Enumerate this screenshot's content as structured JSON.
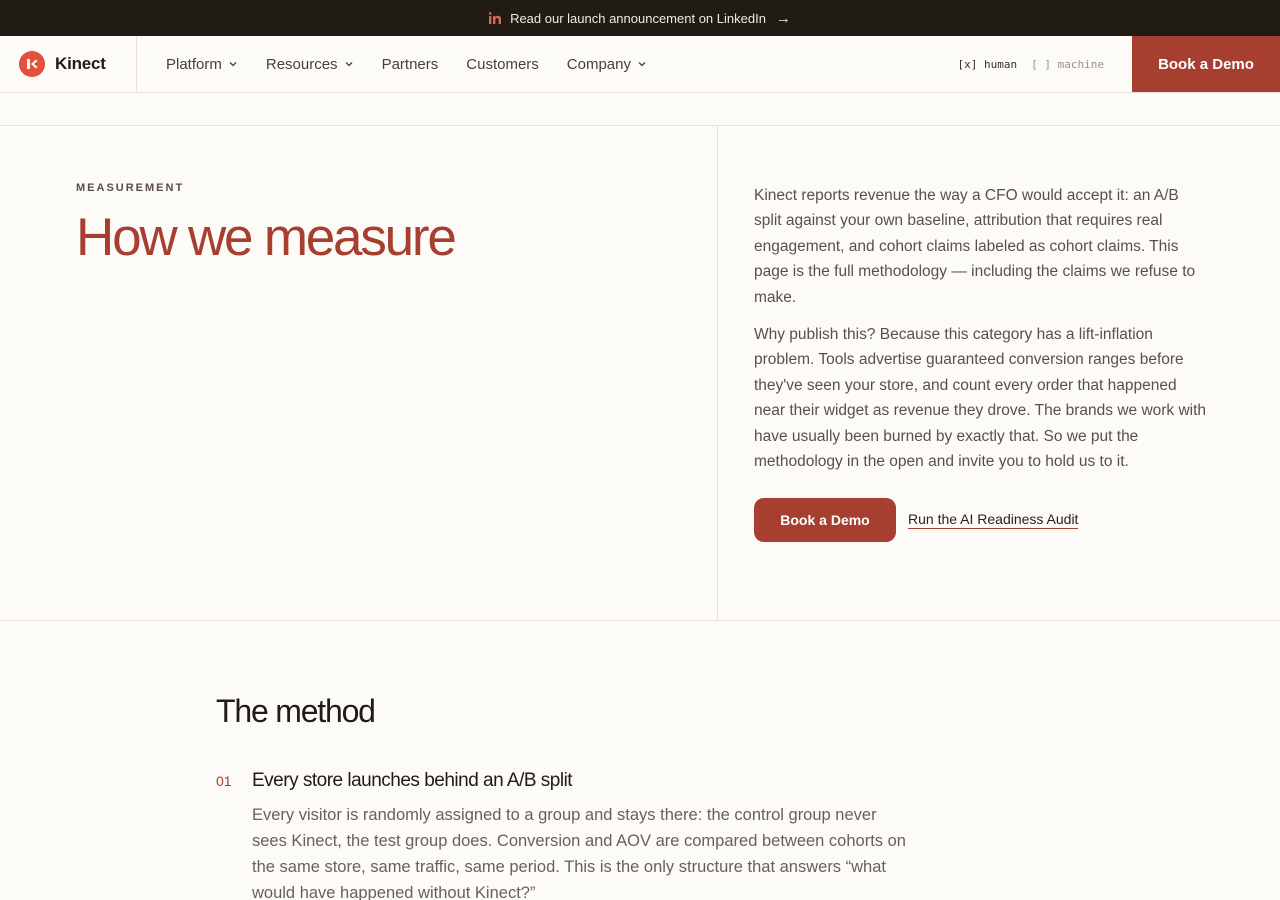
{
  "announcement": {
    "text": "Read our launch announcement on LinkedIn",
    "arrow": "→",
    "icon": "linkedin-icon"
  },
  "brand": {
    "name": "Kinect",
    "logo_color": "#e2513b"
  },
  "nav": {
    "items": [
      {
        "label": "Platform",
        "has_dropdown": true
      },
      {
        "label": "Resources",
        "has_dropdown": true
      },
      {
        "label": "Partners",
        "has_dropdown": false
      },
      {
        "label": "Customers",
        "has_dropdown": false
      },
      {
        "label": "Company",
        "has_dropdown": true
      }
    ],
    "mode_toggle": {
      "human": "[x] human",
      "machine": "[ ] machine"
    },
    "cta": "Book a Demo"
  },
  "hero": {
    "eyebrow": "MEASUREMENT",
    "title": "How we measure",
    "paragraphs": [
      "Kinect reports revenue the way a CFO would accept it: an A/B split against your own baseline, attribution that requires real engagement, and cohort claims labeled as cohort claims. This page is the full methodology — including the claims we refuse to make.",
      "Why publish this? Because this category has a lift-inflation problem. Tools advertise guaranteed conversion ranges before they've seen your store, and count every order that happened near their widget as revenue they drove. The brands we work with have usually been burned by exactly that. So we put the methodology in the open and invite you to hold us to it."
    ],
    "primary_cta": "Book a Demo",
    "secondary_cta": "Run the AI Readiness Audit"
  },
  "method": {
    "title": "The method",
    "steps": [
      {
        "number": "01",
        "title": "Every store launches behind an A/B split",
        "text": "Every visitor is randomly assigned to a group and stays there: the control group never sees Kinect, the test group does. Conversion and AOV are compared between cohorts on the same store, same traffic, same period. This is the only structure that answers “what would have happened without Kinect?”"
      }
    ]
  },
  "colors": {
    "accent": "#a63f2f",
    "announcement_bg": "#211b16",
    "page_bg": "#fcfbf8"
  }
}
